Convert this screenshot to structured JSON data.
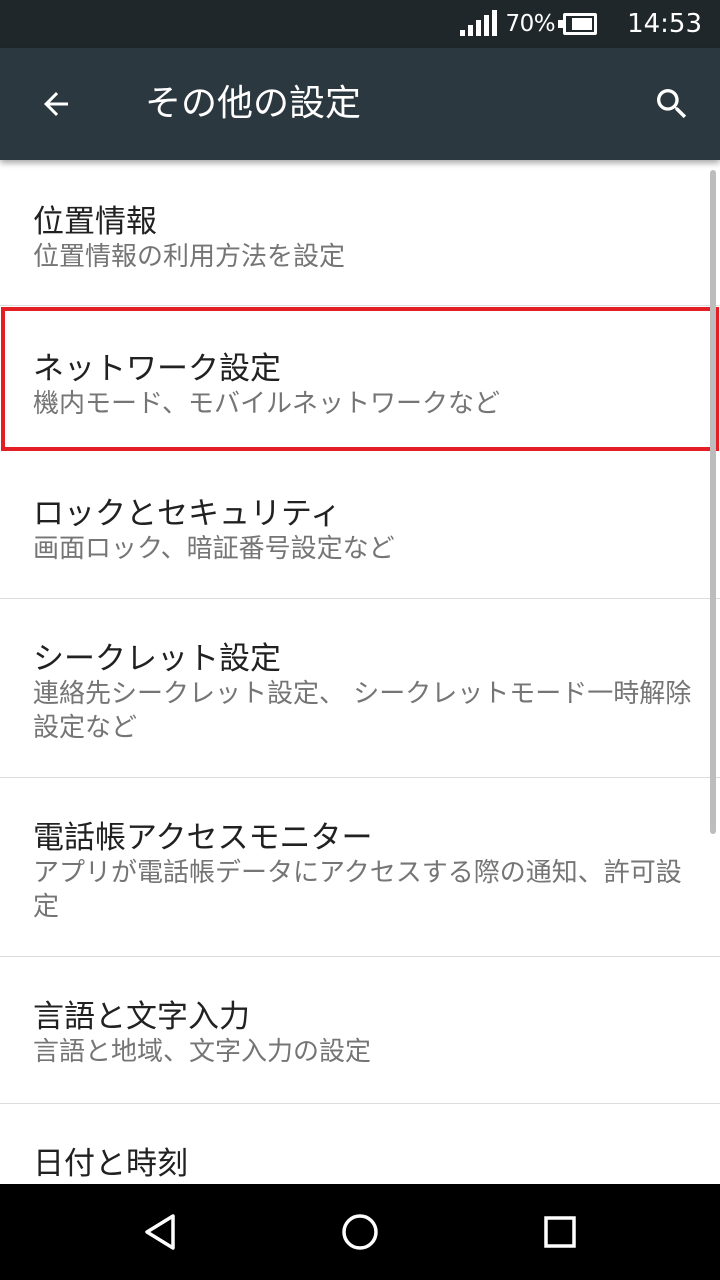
{
  "status_bar": {
    "battery_percent": "70%",
    "time": "14:53",
    "signal_icon": "signal-icon",
    "battery_icon": "battery-icon"
  },
  "app_bar": {
    "title": "その他の設定",
    "back_icon": "arrow-back-icon",
    "search_icon": "search-icon"
  },
  "settings": {
    "items": [
      {
        "title": "位置情報",
        "summary": "位置情報の利用方法を設定"
      },
      {
        "title": "ネットワーク設定",
        "summary": "機内モード、モバイルネットワークなど"
      },
      {
        "title": "ロックとセキュリティ",
        "summary": "画面ロック、暗証番号設定など"
      },
      {
        "title": "シークレット設定",
        "summary": "連絡先シークレット設定、 シークレットモード一時解除設定など"
      },
      {
        "title": "電話帳アクセスモニター",
        "summary": "アプリが電話帳データにアクセスする際の通知、許可設定"
      },
      {
        "title": "言語と文字入力",
        "summary": "言語と地域、文字入力の設定"
      },
      {
        "title": "日付と時刻",
        "summary": ""
      }
    ]
  },
  "highlight": {
    "color": "#e31e24",
    "item": "ネットワーク設定"
  },
  "nav_bar": {
    "back_icon": "nav-back-icon",
    "home_icon": "nav-home-icon",
    "recents_icon": "nav-recents-icon"
  },
  "colors": {
    "status_bar": "#1f272b",
    "app_bar": "#2b383f",
    "title_text": "#212121",
    "summary_text": "#757575"
  }
}
